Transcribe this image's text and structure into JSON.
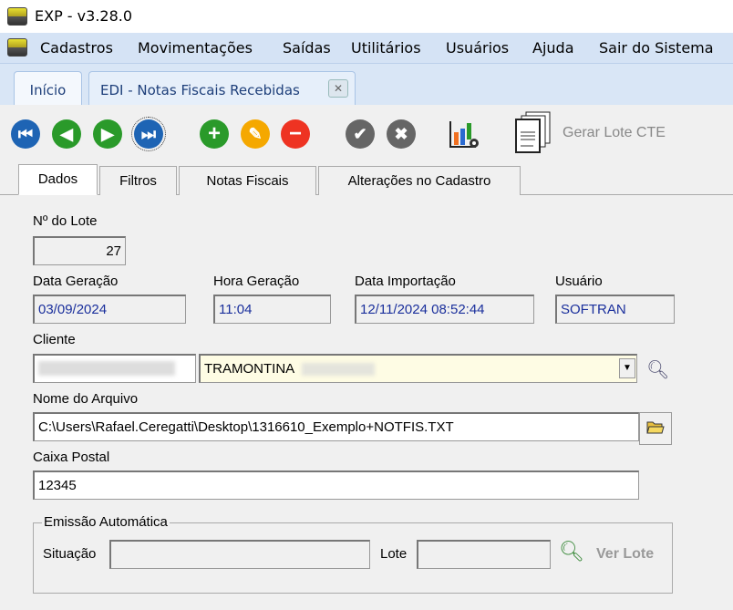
{
  "window": {
    "title": "EXP - v3.28.0"
  },
  "menu": [
    "Cadastros",
    "Movimentações",
    "Saídas",
    "Utilitários",
    "Usuários",
    "Ajuda",
    "Sair do Sistema"
  ],
  "window_tabs": [
    {
      "label": "Início"
    },
    {
      "label": "EDI - Notas Fiscais Recebidas",
      "close": "✕"
    }
  ],
  "toolbar": {
    "gerar_lote": "Gerar Lote CTE"
  },
  "tabs": [
    "Dados",
    "Filtros",
    "Notas Fiscais",
    "Alterações no Cadastro"
  ],
  "form": {
    "lote_label": "Nº do Lote",
    "lote": "27",
    "data_geracao_label": "Data Geração",
    "data_geracao": "03/09/2024",
    "hora_geracao_label": "Hora Geração",
    "hora_geracao": "11:04",
    "data_importacao_label": "Data Importação",
    "data_importacao": "12/11/2024 08:52:44",
    "usuario_label": "Usuário",
    "usuario": "SOFTRAN",
    "cliente_label": "Cliente",
    "cliente_nome": "TRAMONTINA",
    "arquivo_label": "Nome do Arquivo",
    "arquivo": "C:\\Users\\Rafael.Ceregatti\\Desktop\\1316610_Exemplo+NOTFIS.TXT",
    "caixa_label": "Caixa Postal",
    "caixa": "12345"
  },
  "emissao": {
    "legend": "Emissão Automática",
    "situacao_label": "Situação",
    "situacao": "",
    "lote_label": "Lote",
    "lote": "",
    "ver_lote": "Ver Lote"
  }
}
